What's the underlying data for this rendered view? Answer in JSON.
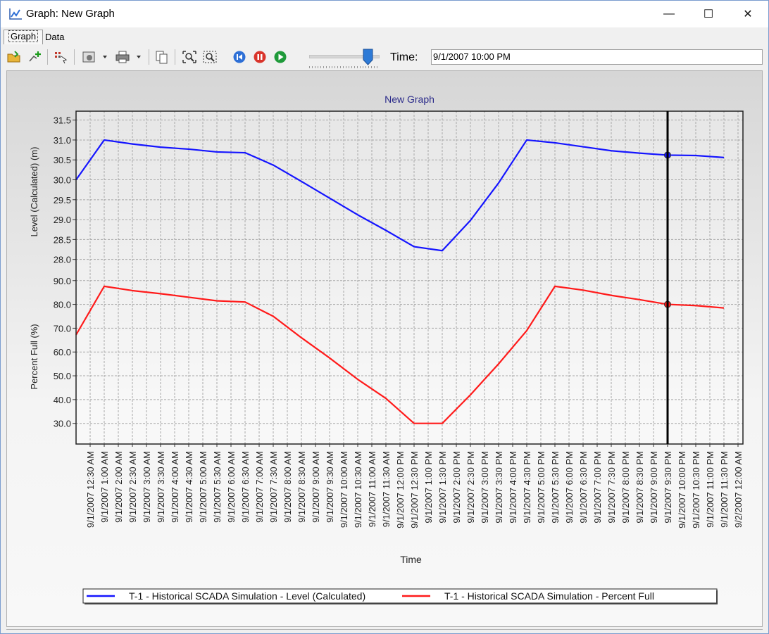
{
  "window": {
    "title": "Graph: New Graph",
    "minimize_glyph": "—",
    "maximize_glyph": "☐",
    "close_glyph": "✕"
  },
  "tabs": [
    {
      "label": "Graph",
      "active": true
    },
    {
      "label": "Data",
      "active": false
    }
  ],
  "toolbar": {
    "icons": [
      "open-folder-icon",
      "add-series-icon",
      "series-select-icon",
      "settings-icon",
      "print-icon",
      "copy-icon",
      "zoom-extents-icon",
      "zoom-window-icon",
      "rewind-icon",
      "pause-icon",
      "play-icon"
    ],
    "time_label": "Time:",
    "time_value": "9/1/2007 10:00 PM",
    "slider_position": 0.87
  },
  "colors": {
    "level": "#1515ff",
    "percent": "#ff1a1a",
    "accent": "#2d6fd6"
  },
  "chart_data": {
    "type": "line",
    "title": "New Graph",
    "xlabel": "Time",
    "categories": [
      "9/1/2007 12:30 AM",
      "9/1/2007 1:00 AM",
      "9/1/2007 2:00 AM",
      "9/1/2007 2:30 AM",
      "9/1/2007 3:00 AM",
      "9/1/2007 3:30 AM",
      "9/1/2007 4:00 AM",
      "9/1/2007 4:30 AM",
      "9/1/2007 5:00 AM",
      "9/1/2007 5:30 AM",
      "9/1/2007 6:00 AM",
      "9/1/2007 6:30 AM",
      "9/1/2007 7:00 AM",
      "9/1/2007 7:30 AM",
      "9/1/2007 8:00 AM",
      "9/1/2007 8:30 AM",
      "9/1/2007 9:00 AM",
      "9/1/2007 9:30 AM",
      "9/1/2007 10:00 AM",
      "9/1/2007 10:30 AM",
      "9/1/2007 11:00 AM",
      "9/1/2007 11:30 AM",
      "9/1/2007 12:00 PM",
      "9/1/2007 12:30 PM",
      "9/1/2007 1:00 PM",
      "9/1/2007 1:30 PM",
      "9/1/2007 2:00 PM",
      "9/1/2007 2:30 PM",
      "9/1/2007 3:00 PM",
      "9/1/2007 3:30 PM",
      "9/1/2007 4:00 PM",
      "9/1/2007 4:30 PM",
      "9/1/2007 5:00 PM",
      "9/1/2007 5:30 PM",
      "9/1/2007 6:00 PM",
      "9/1/2007 6:30 PM",
      "9/1/2007 7:00 PM",
      "9/1/2007 7:30 PM",
      "9/1/2007 8:00 PM",
      "9/1/2007 8:30 PM",
      "9/1/2007 9:00 PM",
      "9/1/2007 9:30 PM",
      "9/1/2007 10:00 PM",
      "9/1/2007 10:30 PM",
      "9/1/2007 11:00 PM",
      "9/1/2007 11:30 PM",
      "9/2/2007 12:00 AM"
    ],
    "x_start_offset": -1,
    "panels": [
      {
        "ylabel": "Level (Calculated) (m)",
        "ylim": [
          27.8,
          31.6
        ],
        "yticks": [
          "28.0",
          "28.5",
          "29.0",
          "29.5",
          "30.0",
          "30.5",
          "31.0",
          "31.5"
        ],
        "series": [
          {
            "name": "T-1 - Historical SCADA Simulation - Level (Calculated)",
            "color": "#1515ff",
            "points": [
              [
                -1,
                30.0
              ],
              [
                1,
                31.0
              ],
              [
                3,
                30.9
              ],
              [
                5,
                30.82
              ],
              [
                7,
                30.77
              ],
              [
                9,
                30.7
              ],
              [
                11,
                30.68
              ],
              [
                13,
                30.37
              ],
              [
                15,
                29.96
              ],
              [
                17,
                29.54
              ],
              [
                19,
                29.12
              ],
              [
                21,
                28.73
              ],
              [
                23,
                28.32
              ],
              [
                25,
                28.22
              ],
              [
                27,
                28.98
              ],
              [
                29,
                29.92
              ],
              [
                31,
                31.0
              ],
              [
                33,
                30.93
              ],
              [
                35,
                30.83
              ],
              [
                37,
                30.73
              ],
              [
                39,
                30.67
              ],
              [
                41,
                30.62
              ],
              [
                43,
                30.61
              ],
              [
                45,
                30.56
              ]
            ],
            "marker": [
              41,
              30.62
            ]
          }
        ]
      },
      {
        "ylabel": "Percent Full (%)",
        "ylim": [
          24,
          92
        ],
        "yticks": [
          "30.0",
          "40.0",
          "50.0",
          "60.0",
          "70.0",
          "80.0",
          "90.0"
        ],
        "series": [
          {
            "name": "T-1 - Historical SCADA Simulation - Percent Full",
            "color": "#ff1a1a",
            "points": [
              [
                -1,
                67.2
              ],
              [
                1,
                87.6
              ],
              [
                3,
                85.8
              ],
              [
                5,
                84.5
              ],
              [
                7,
                83.0
              ],
              [
                9,
                81.5
              ],
              [
                11,
                81.0
              ],
              [
                13,
                75.0
              ],
              [
                15,
                66.0
              ],
              [
                17,
                57.5
              ],
              [
                19,
                48.5
              ],
              [
                21,
                40.5
              ],
              [
                23,
                30.0
              ],
              [
                25,
                30.0
              ],
              [
                27,
                42.0
              ],
              [
                29,
                55.0
              ],
              [
                31,
                69.0
              ],
              [
                33,
                87.6
              ],
              [
                35,
                86.0
              ],
              [
                37,
                83.8
              ],
              [
                39,
                82.0
              ],
              [
                41,
                80.0
              ],
              [
                43,
                79.5
              ],
              [
                45,
                78.5
              ]
            ],
            "marker": [
              41,
              80.0
            ]
          }
        ]
      }
    ],
    "cursor_x": 41,
    "legend": [
      {
        "label": "T-1 - Historical SCADA Simulation - Level (Calculated)",
        "color": "#1515ff"
      },
      {
        "label": "T-1 - Historical SCADA Simulation - Percent Full",
        "color": "#ff1a1a"
      }
    ],
    "legend_position": "bottom",
    "grid": true
  }
}
